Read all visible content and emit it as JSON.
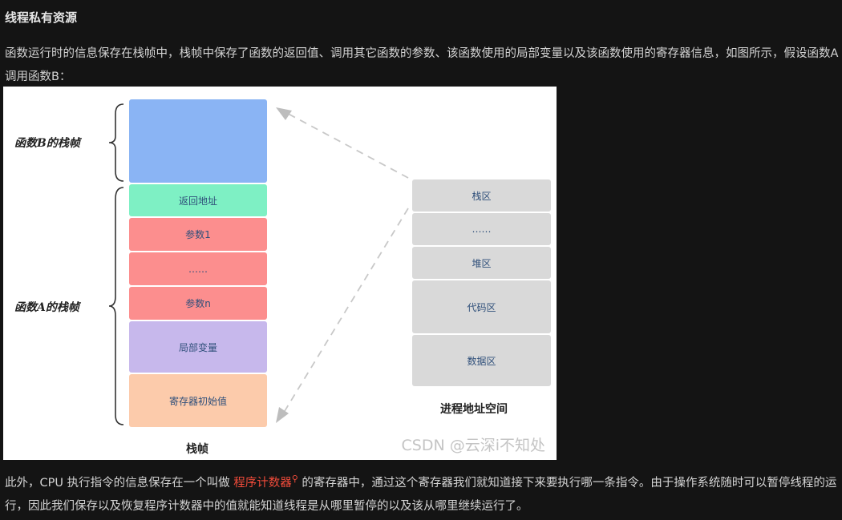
{
  "heading": "线程私有资源",
  "para1": "函数运行时的信息保存在栈帧中，栈帧中保存了函数的返回值、调用其它函数的参数、该函数使用的局部变量以及该函数使用的寄存器信息，如图所示，假设函数A调用函数B：",
  "figure": {
    "label_b": "函数B的栈帧",
    "label_a": "函数A的栈帧",
    "stack_blocks": [
      "返回地址",
      "参数1",
      "……",
      "参数n",
      "局部变量",
      "寄存器初始值"
    ],
    "stack_caption": "栈帧",
    "address_blocks": [
      "栈区",
      "……",
      "堆区",
      "代码区",
      "数据区"
    ],
    "address_caption": "进程地址空间",
    "watermark": "CSDN @云深i不知处",
    "colors": {
      "block_b": "#8ab4f4",
      "return_address": "#7ef0c4",
      "params": "#fc8e8e",
      "locals": "#c7b8ec",
      "registers": "#fccbab",
      "address_space": "#d9d9d9"
    }
  },
  "para2": {
    "before": "此外，CPU 执行指令的信息保存在一个叫做 ",
    "link": "程序计数器",
    "after": " 的寄存器中，通过这个寄存器我们就知道接下来要执行哪一条指令。由于操作系统随时可以暂停线程的运行，因此我们保存以及恢复程序计数器中的值就能知道线程是从哪里暂停的以及该从哪里继续运行了。"
  }
}
